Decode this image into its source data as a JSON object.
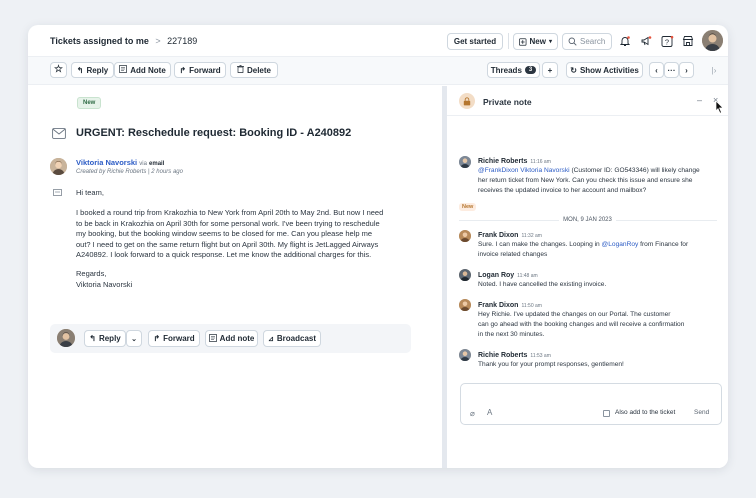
{
  "header": {
    "breadcrumb_title": "Tickets assigned to me",
    "breadcrumb_sep": ">",
    "ticket_id": "227189",
    "get_started": "Get started",
    "new_label": "New",
    "search_placeholder": "Search"
  },
  "toolbar": {
    "reply": "Reply",
    "add_note": "Add Note",
    "forward": "Forward",
    "delete": "Delete",
    "threads": "Threads",
    "threads_count": "3",
    "plus": "+",
    "show_activities": "Show Activities",
    "prev": "‹",
    "more": "···",
    "next": "›"
  },
  "ticket": {
    "status_tag": "New",
    "subject": "URGENT: Reschedule request: Booking ID - A240892",
    "sender_name": "Viktoria Navorski",
    "via": "via",
    "channel": "email",
    "created_by": "Created by Richie Roberts",
    "created_sep": "|",
    "created_time": "2 hours ago",
    "greeting": "Hi team,",
    "body_lines": [
      "I booked a round trip from Krakozhia to New York from April 20th to May 2nd. But now I need",
      "to be  back in Krakozhia on April 30th for some personal work. I've been trying to reschedule",
      "my booking,  but the booking window seems to be closed for me. Can you please help me",
      "out? I need to get on  the same return flight but on April 30th. My flight is JetLagged Airways",
      "A240892.   I look forward to a quick response. Let me know the additional charges for this."
    ],
    "regards": "Regards,",
    "signature": "Viktoria Navorski"
  },
  "reply_bar": {
    "reply": "Reply",
    "forward": "Forward",
    "add_note": "Add note",
    "broadcast": "Broadcast"
  },
  "note_panel": {
    "title": "Private note",
    "minimize": "–",
    "close": "×",
    "date_separator": "MON, 9 JAN 2023",
    "messages": [
      {
        "name": "Richie Roberts",
        "time": "11:16 am",
        "mention1": "@FrankDixon",
        "mention2": "Viktoria Navorski",
        "line1_rest": "(Customer ID: GO543346) will likely change",
        "line2": "her return ticket from New York. Can you check this issue and ensure she",
        "line3": "receives the updated invoice to her account and mailbox?",
        "tag": "New"
      },
      {
        "name": "Frank Dixon",
        "time": "11:32 am",
        "line1_pre": "Sure. I can make the changes. Looping in",
        "mention": "@LoganRoy",
        "line1_post": "from Finance for",
        "line2": "invoice related changes"
      },
      {
        "name": "Logan Roy",
        "time": "11:48 am",
        "line1": "Noted. I have cancelled the existing invoice."
      },
      {
        "name": "Frank Dixon",
        "time": "11:50 am",
        "line1": "Hey Richie. I've updated the changes on our Portal. The customer",
        "line2": "can go ahead with the booking changes and will receive a confirmation",
        "line3": "in the next 30 minutes."
      },
      {
        "name": "Richie Roberts",
        "time": "11:53 am",
        "line1": "Thank you for your prompt responses, gentlemen!"
      }
    ],
    "composer": {
      "also_add": "Also add to the ticket",
      "send": "Send"
    }
  }
}
